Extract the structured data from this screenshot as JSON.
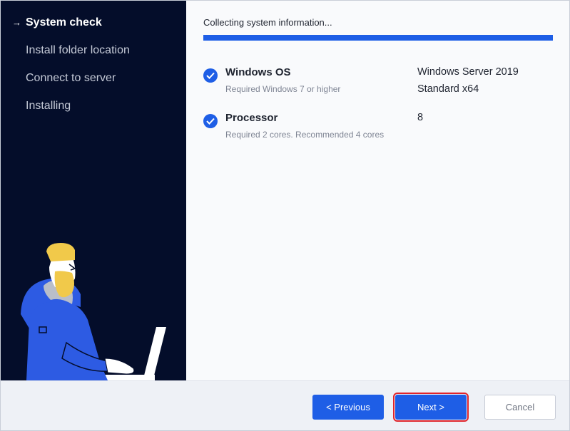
{
  "sidebar": {
    "steps": [
      {
        "label": "System check",
        "active": true
      },
      {
        "label": "Install folder location",
        "active": false
      },
      {
        "label": "Connect to server",
        "active": false
      },
      {
        "label": "Installing",
        "active": false
      }
    ],
    "active_marker": "→"
  },
  "main": {
    "status": "Collecting system information...",
    "progress_percent": 100,
    "checks": [
      {
        "title": "Windows OS",
        "requirement": "Required Windows 7 or higher",
        "value": "Windows Server 2019 Standard x64",
        "icon": "check-circle-icon"
      },
      {
        "title": "Processor",
        "requirement": "Required 2 cores. Recommended 4 cores",
        "value": "8",
        "icon": "check-circle-icon"
      }
    ]
  },
  "footer": {
    "previous_label": "< Previous",
    "next_label": "Next >",
    "cancel_label": "Cancel"
  },
  "colors": {
    "sidebar_bg": "#040d2a",
    "accent": "#1e5ee6",
    "highlight_border": "#e0242b"
  }
}
